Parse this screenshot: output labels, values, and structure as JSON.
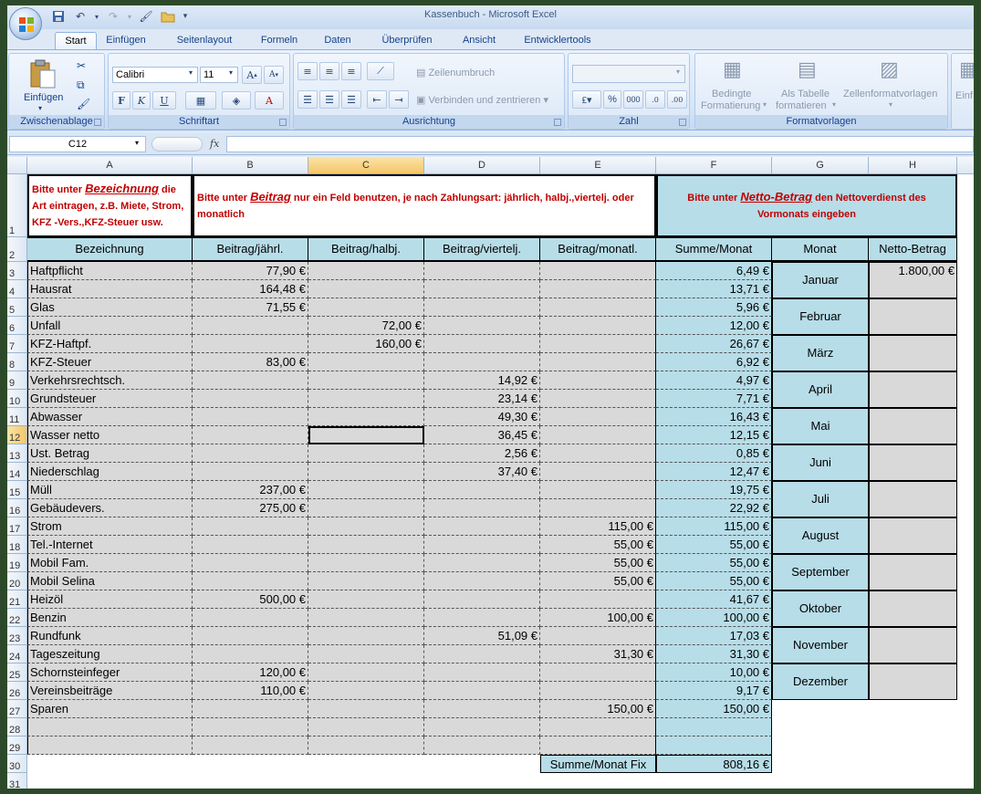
{
  "window": {
    "title": "Kassenbuch - Microsoft Excel"
  },
  "ribbon": {
    "tabs": [
      "Start",
      "Einfügen",
      "Seitenlayout",
      "Formeln",
      "Daten",
      "Überprüfen",
      "Ansicht",
      "Entwicklertools"
    ],
    "active_tab": "Start",
    "clipboard": {
      "paste_label": "Einfügen",
      "group_label": "Zwischenablage"
    },
    "font": {
      "name": "Calibri",
      "size": "11",
      "bold": "F",
      "italic": "K",
      "underline": "U",
      "group_label": "Schriftart"
    },
    "alignment": {
      "wrap_label": "Zeilenumbruch",
      "merge_label": "Verbinden und zentrieren",
      "group_label": "Ausrichtung"
    },
    "number": {
      "format_value": "",
      "percent": "%",
      "thousands": "000",
      "group_label": "Zahl"
    },
    "styles": {
      "conditional_label_1": "Bedingte",
      "conditional_label_2": "Formatierung",
      "table_label_1": "Als Tabelle",
      "table_label_2": "formatieren",
      "cellstyles_label": "Zellenformatvorlagen",
      "group_label": "Formatvorlagen"
    },
    "cells": {
      "insert_label": "Einf"
    }
  },
  "formula_bar": {
    "name_box": "C12",
    "fx": "fx",
    "content": ""
  },
  "sheet": {
    "columns": [
      "A",
      "B",
      "C",
      "D",
      "E",
      "F",
      "G",
      "H"
    ],
    "selected_column": "C",
    "selected_row": "12",
    "row_numbers": [
      "1",
      "2",
      "3",
      "4",
      "5",
      "6",
      "7",
      "8",
      "9",
      "10",
      "11",
      "12",
      "13",
      "14",
      "15",
      "16",
      "17",
      "18",
      "19",
      "20",
      "21",
      "22",
      "23",
      "24",
      "25",
      "26",
      "27",
      "28",
      "29",
      "30",
      "31"
    ],
    "hints": {
      "a_pre": "Bitte unter ",
      "a_em": "Bezeichnung",
      "a_post": " die Art eintragen, z.B. Miete, Strom, KFZ -Vers.,KFZ-Steuer usw.",
      "bcde_pre": "Bitte unter ",
      "bcde_em": "Beitrag",
      "bcde_post": " nur ein Feld benutzen, je nach Zahlungsart: jährlich, halbj.,viertelj. oder monatlich",
      "fgh_pre": "Bitte unter ",
      "fgh_em": "Netto-Betrag",
      "fgh_post": " den Nettoverdienst des Vormonats eingeben"
    },
    "headers": [
      "Bezeichnung",
      "Beitrag/jährl.",
      "Beitrag/halbj.",
      "Beitrag/viertelj.",
      "Beitrag/monatl.",
      "Summe/Monat",
      "Monat",
      "Netto-Betrag"
    ],
    "rows": [
      {
        "a": "Haftpflicht",
        "b": "77,90 €",
        "c": "",
        "d": "",
        "e": "",
        "f": "6,49 €"
      },
      {
        "a": "Hausrat",
        "b": "164,48 €",
        "c": "",
        "d": "",
        "e": "",
        "f": "13,71 €"
      },
      {
        "a": "Glas",
        "b": "71,55 €",
        "c": "",
        "d": "",
        "e": "",
        "f": "5,96 €"
      },
      {
        "a": "Unfall",
        "b": "",
        "c": "72,00 €",
        "d": "",
        "e": "",
        "f": "12,00 €"
      },
      {
        "a": "KFZ-Haftpf.",
        "b": "",
        "c": "160,00 €",
        "d": "",
        "e": "",
        "f": "26,67 €"
      },
      {
        "a": "KFZ-Steuer",
        "b": "83,00 €",
        "c": "",
        "d": "",
        "e": "",
        "f": "6,92 €"
      },
      {
        "a": "Verkehrsrechtsch.",
        "b": "",
        "c": "",
        "d": "14,92 €",
        "e": "",
        "f": "4,97 €"
      },
      {
        "a": "Grundsteuer",
        "b": "",
        "c": "",
        "d": "23,14 €",
        "e": "",
        "f": "7,71 €"
      },
      {
        "a": "Abwasser",
        "b": "",
        "c": "",
        "d": "49,30 €",
        "e": "",
        "f": "16,43 €"
      },
      {
        "a": "Wasser netto",
        "b": "",
        "c": "",
        "d": "36,45 €",
        "e": "",
        "f": "12,15 €"
      },
      {
        "a": "Ust. Betrag",
        "b": "",
        "c": "",
        "d": "2,56 €",
        "e": "",
        "f": "0,85 €"
      },
      {
        "a": "Niederschlag",
        "b": "",
        "c": "",
        "d": "37,40 €",
        "e": "",
        "f": "12,47 €"
      },
      {
        "a": "Müll",
        "b": "237,00 €",
        "c": "",
        "d": "",
        "e": "",
        "f": "19,75 €"
      },
      {
        "a": "Gebäudevers.",
        "b": "275,00 €",
        "c": "",
        "d": "",
        "e": "",
        "f": "22,92 €"
      },
      {
        "a": "Strom",
        "b": "",
        "c": "",
        "d": "",
        "e": "115,00 €",
        "f": "115,00 €"
      },
      {
        "a": "Tel.-Internet",
        "b": "",
        "c": "",
        "d": "",
        "e": "55,00 €",
        "f": "55,00 €"
      },
      {
        "a": "Mobil Fam.",
        "b": "",
        "c": "",
        "d": "",
        "e": "55,00 €",
        "f": "55,00 €"
      },
      {
        "a": "Mobil Selina",
        "b": "",
        "c": "",
        "d": "",
        "e": "55,00 €",
        "f": "55,00 €"
      },
      {
        "a": "Heizöl",
        "b": "500,00 €",
        "c": "",
        "d": "",
        "e": "",
        "f": "41,67 €"
      },
      {
        "a": "Benzin",
        "b": "",
        "c": "",
        "d": "",
        "e": "100,00 €",
        "f": "100,00 €"
      },
      {
        "a": "Rundfunk",
        "b": "",
        "c": "",
        "d": "51,09 €",
        "e": "",
        "f": "17,03 €"
      },
      {
        "a": "Tageszeitung",
        "b": "",
        "c": "",
        "d": "",
        "e": "31,30 €",
        "f": "31,30 €"
      },
      {
        "a": "Schornsteinfeger",
        "b": "120,00 €",
        "c": "",
        "d": "",
        "e": "",
        "f": "10,00 €"
      },
      {
        "a": "Vereinsbeiträge",
        "b": "110,00 €",
        "c": "",
        "d": "",
        "e": "",
        "f": "9,17 €"
      },
      {
        "a": "Sparen",
        "b": "",
        "c": "",
        "d": "",
        "e": "150,00 €",
        "f": "150,00 €"
      },
      {
        "a": "",
        "b": "",
        "c": "",
        "d": "",
        "e": "",
        "f": ""
      },
      {
        "a": "",
        "b": "",
        "c": "",
        "d": "",
        "e": "",
        "f": ""
      }
    ],
    "months": [
      {
        "monat": "Januar",
        "netto": "1.800,00 €"
      },
      {
        "monat": "Februar",
        "netto": ""
      },
      {
        "monat": "März",
        "netto": ""
      },
      {
        "monat": "April",
        "netto": ""
      },
      {
        "monat": "Mai",
        "netto": ""
      },
      {
        "monat": "Juni",
        "netto": ""
      },
      {
        "monat": "Juli",
        "netto": ""
      },
      {
        "monat": "August",
        "netto": ""
      },
      {
        "monat": "September",
        "netto": ""
      },
      {
        "monat": "Oktober",
        "netto": ""
      },
      {
        "monat": "November",
        "netto": ""
      },
      {
        "monat": "Dezember",
        "netto": ""
      }
    ],
    "total_label": "Summe/Monat Fix",
    "total_value": "808,16 €"
  },
  "colors": {
    "hint_red": "#c00000",
    "input_blue": "#b7dde8",
    "input_gray": "#d9d9d9"
  }
}
